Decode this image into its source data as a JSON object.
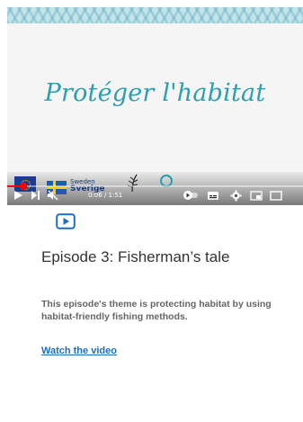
{
  "video": {
    "title_text": "Protéger l'habitat",
    "time_display": "0:06 / 1:51",
    "progress": 0.054,
    "sponsor_text_line1": "Sweden",
    "sponsor_text_line2": "Sverige",
    "icons": {
      "play": "play-icon",
      "next": "next-icon",
      "mute": "mute-icon",
      "autoplay": "autoplay-toggle-icon",
      "captions": "captions-icon",
      "settings": "settings-icon",
      "miniplayer": "miniplayer-icon",
      "fullscreen": "fullscreen-icon"
    },
    "colors": {
      "title": "#2a9fae",
      "progress": "#ff0000",
      "pattern": "#c5e4ea"
    }
  },
  "episode": {
    "icon": "play-square-icon",
    "title": "Episode 3: Fisherman’s tale",
    "description": "This episode's theme is protecting habitat by using habitat-friendly fishing methods.",
    "link_label": "Watch the video"
  },
  "colors": {
    "accent": "#1a6fc0",
    "icon": "#1a6fc0"
  }
}
